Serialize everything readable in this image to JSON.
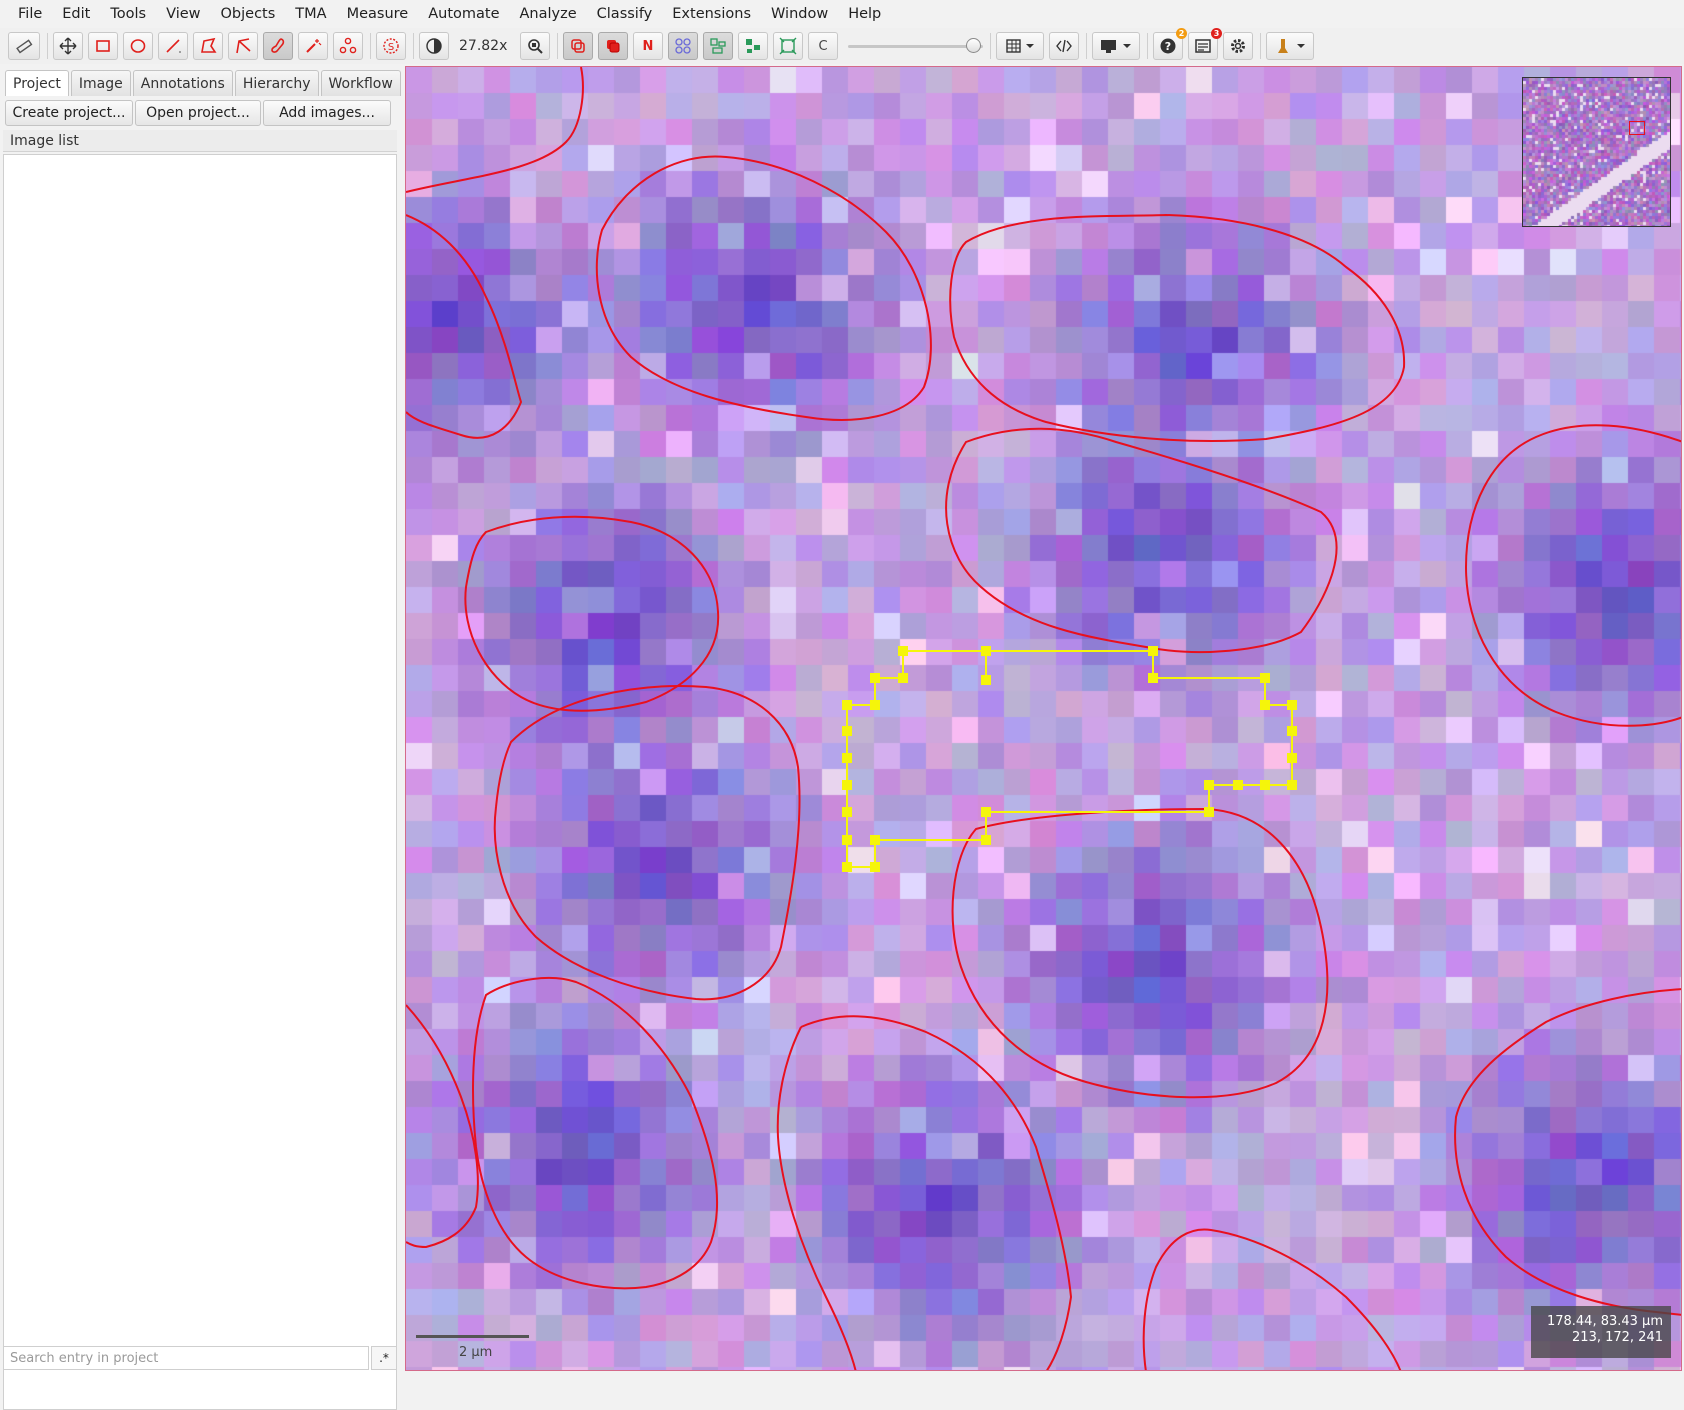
{
  "menu": [
    "File",
    "Edit",
    "Tools",
    "View",
    "Objects",
    "TMA",
    "Measure",
    "Automate",
    "Analyze",
    "Classify",
    "Extensions",
    "Window",
    "Help"
  ],
  "toolbar": {
    "zoom_label": "27.82x",
    "n_button_label": "N",
    "c_button_label": "C",
    "help_badge": "2",
    "log_badge": "3",
    "icons": [
      "ruler-icon",
      "move-icon",
      "rectangle-icon",
      "ellipse-icon",
      "line-icon",
      "polygon-icon",
      "polyline-icon",
      "brush-icon",
      "wand-icon",
      "points-icon",
      "selection-mode-icon",
      "brightness-contrast-icon",
      "zoom-to-fit-icon",
      "show-annotations-icon",
      "fill-annotations-icon",
      "show-names-icon",
      "show-detections-icon",
      "fill-detections-icon",
      "show-connections-icon",
      "show-tma-grid-icon",
      "show-pixel-classification-icon",
      "measurement-table-icon",
      "script-editor-icon",
      "display-icon",
      "help-icon",
      "log-icon",
      "preferences-icon",
      "extensions-icon"
    ]
  },
  "left_panel": {
    "tabs": [
      "Project",
      "Image",
      "Annotations",
      "Hierarchy",
      "Workflow"
    ],
    "active_tab": "Project",
    "buttons": [
      "Create project...",
      "Open project...",
      "Add images..."
    ],
    "image_list_header": "Image list",
    "search_placeholder": "Search entry in project",
    "regex_label": ".*"
  },
  "viewer": {
    "scalebar_label": "2 µm",
    "coords_line1": "178.44, 83.43 µm",
    "coords_line2": "213, 172, 241",
    "annotation_color": "#e8101e",
    "selected_color": "#f5f50a"
  }
}
